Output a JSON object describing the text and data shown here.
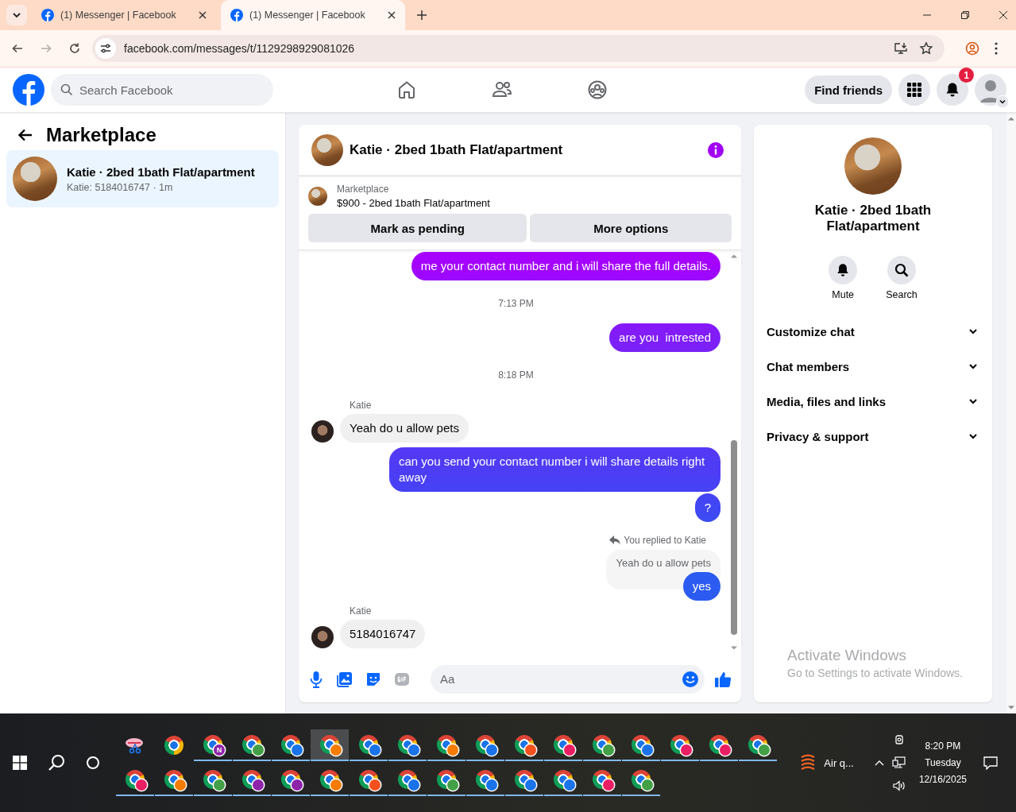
{
  "browser": {
    "tabs": [
      {
        "title": "(1) Messenger | Facebook",
        "selected": false
      },
      {
        "title": "(1) Messenger | Facebook",
        "selected": true
      }
    ],
    "url": "facebook.com/messages/t/1129298929081026",
    "forward_disabled": true
  },
  "header": {
    "search": {
      "placeholder": "Search Facebook"
    },
    "nav": [
      {
        "kind": "home"
      },
      {
        "kind": "friends"
      },
      {
        "kind": "groups"
      }
    ],
    "find_friends": "Find friends",
    "notification_count": "1"
  },
  "sidebar": {
    "title": "Marketplace",
    "conversations": [
      {
        "title": "Katie · 2bed 1bath Flat/apartment",
        "preview": "Katie: 5184016747 · 1m",
        "selected": true
      }
    ]
  },
  "chat": {
    "title": "Katie · 2bed 1bath Flat/apartment",
    "listing": {
      "label": "Marketplace",
      "title": "$900 - 2bed 1bath Flat/apartment",
      "buttons": [
        "Mark as pending",
        "More options"
      ]
    },
    "messages": [
      {
        "kind": "sent",
        "text": "me your contact number and i will share the full details."
      },
      {
        "kind": "time",
        "text": "7:13 PM"
      },
      {
        "kind": "sent",
        "text": "are you  intrested"
      },
      {
        "kind": "time",
        "text": "8:18 PM"
      },
      {
        "kind": "received",
        "sender": "Katie",
        "text": "Yeah do u allow pets"
      },
      {
        "kind": "sent",
        "text": "can you send your contact number i will share details right away"
      },
      {
        "kind": "sent",
        "text": "?"
      },
      {
        "kind": "reply",
        "label": "You replied to Katie",
        "quote": "Yeah do u allow pets",
        "text": "yes"
      },
      {
        "kind": "received",
        "sender": "Katie",
        "text": "5184016747"
      }
    ],
    "composer": {
      "placeholder": "Aa"
    }
  },
  "details": {
    "name": "Katie · 2bed 1bath Flat/apartment",
    "actions": [
      {
        "kind": "mute",
        "label": "Mute"
      },
      {
        "kind": "search",
        "label": "Search"
      }
    ],
    "sections": [
      {
        "label": "Customize chat",
        "expanded": false
      },
      {
        "label": "Chat members",
        "expanded": false
      },
      {
        "label": "Media, files and links",
        "expanded": false
      },
      {
        "label": "Privacy & support",
        "expanded": false
      }
    ]
  },
  "activation_notice": {
    "title": "Activate Windows",
    "subtitle": "Go to Settings to activate Windows."
  },
  "taskbar": {
    "rows": [
      [
        {
          "kind": "snip",
          "selected": false
        },
        {
          "kind": "chrome",
          "selected": false
        },
        {
          "kind": "profile",
          "color": "#8e24aa",
          "letter": "N",
          "selected": false
        },
        {
          "kind": "profile",
          "color": "#43a047",
          "selected": false
        },
        {
          "kind": "profile",
          "color": "#1a73e8",
          "selected": false
        },
        {
          "kind": "profile",
          "color": "#f57c00",
          "selected": true
        },
        {
          "kind": "profile",
          "color": "#1a73e8",
          "selected": false
        },
        {
          "kind": "profile",
          "color": "#1a73e8",
          "selected": false
        },
        {
          "kind": "profile",
          "color": "#f57c00",
          "selected": false
        },
        {
          "kind": "profile",
          "color": "#1a73e8",
          "selected": false
        },
        {
          "kind": "profile",
          "color": "#f4511e",
          "selected": false
        },
        {
          "kind": "profile",
          "color": "#e91e63",
          "selected": false
        },
        {
          "kind": "profile",
          "color": "#43a047",
          "selected": false
        },
        {
          "kind": "profile",
          "color": "#1a73e8",
          "selected": false
        },
        {
          "kind": "profile",
          "color": "#e91e63",
          "selected": false
        },
        {
          "kind": "profile",
          "color": "#e91e63",
          "selected": false
        },
        {
          "kind": "profile",
          "color": "#43a047",
          "selected": false
        }
      ],
      [
        {
          "kind": "profile",
          "color": "#e91e63",
          "selected": false
        },
        {
          "kind": "profile",
          "color": "#f57c00",
          "selected": false
        },
        {
          "kind": "profile",
          "color": "#43a047",
          "selected": false
        },
        {
          "kind": "profile",
          "color": "#8e24aa",
          "selected": false
        },
        {
          "kind": "profile",
          "color": "#8e24aa",
          "selected": false
        },
        {
          "kind": "profile",
          "color": "#f57c00",
          "selected": false
        },
        {
          "kind": "profile",
          "color": "#f4511e",
          "selected": false
        },
        {
          "kind": "profile",
          "color": "#1a73e8",
          "selected": false
        },
        {
          "kind": "profile",
          "color": "#43a047",
          "selected": false
        },
        {
          "kind": "profile",
          "color": "#1a73e8",
          "selected": false
        },
        {
          "kind": "profile",
          "color": "#1a73e8",
          "selected": false
        },
        {
          "kind": "profile",
          "color": "#1a73e8",
          "selected": false
        },
        {
          "kind": "profile",
          "color": "#e91e63",
          "selected": false
        },
        {
          "kind": "profile",
          "color": "#43a047",
          "selected": false
        }
      ]
    ],
    "weather": "Air q...",
    "clock": {
      "time": "8:20 PM",
      "day": "Tuesday",
      "date": "12/16/2025"
    }
  }
}
